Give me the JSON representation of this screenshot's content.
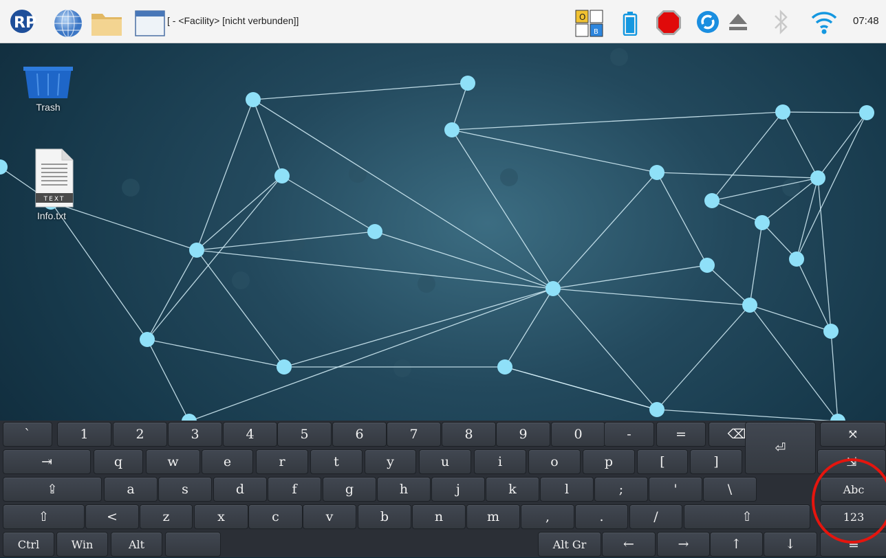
{
  "taskbar": {
    "window_title": "[ - <Facility> [nicht verbunden]]",
    "clock": "07:48",
    "keyboard_indicator": {
      "top_left": "O",
      "bottom_right": "B"
    },
    "icons": [
      "rp-logo-icon",
      "globe-icon",
      "folder-icon",
      "window-icon",
      "keyboard-layout-icon",
      "battery-icon",
      "stop-icon",
      "sync-icon",
      "eject-icon",
      "bluetooth-icon",
      "wifi-icon"
    ]
  },
  "desktop": {
    "icons": [
      {
        "label": "Trash",
        "icon": "trash-icon"
      },
      {
        "label": "Info.txt",
        "icon": "text-file-icon",
        "badge": "TEXT"
      }
    ],
    "wallpaper_colors": {
      "node": "#8fe0f8",
      "line": "#d8f2fb",
      "bg": "#1c4256"
    }
  },
  "keyboard": {
    "rows": [
      [
        "`",
        "1",
        "2",
        "3",
        "4",
        "5",
        "6",
        "7",
        "8",
        "9",
        "0",
        "-",
        "=",
        "⌫",
        "⊠",
        "⤧"
      ],
      [
        "⇥",
        "q",
        "w",
        "e",
        "r",
        "t",
        "y",
        "u",
        "i",
        "o",
        "p",
        "[",
        "]",
        "⏎",
        "⇲"
      ],
      [
        "⇪",
        "a",
        "s",
        "d",
        "f",
        "g",
        "h",
        "j",
        "k",
        "l",
        ";",
        "'",
        "\\",
        "Abc"
      ],
      [
        "⇧",
        "<",
        "z",
        "x",
        "c",
        "v",
        "b",
        "n",
        "m",
        ",",
        ".",
        "/",
        "⇧",
        "123"
      ],
      [
        "Ctrl",
        "Win",
        "Alt",
        " ",
        "Alt Gr",
        "←",
        "→",
        "↑",
        "↓",
        "≡"
      ]
    ]
  },
  "annotation": {
    "color": "#e5150e"
  }
}
